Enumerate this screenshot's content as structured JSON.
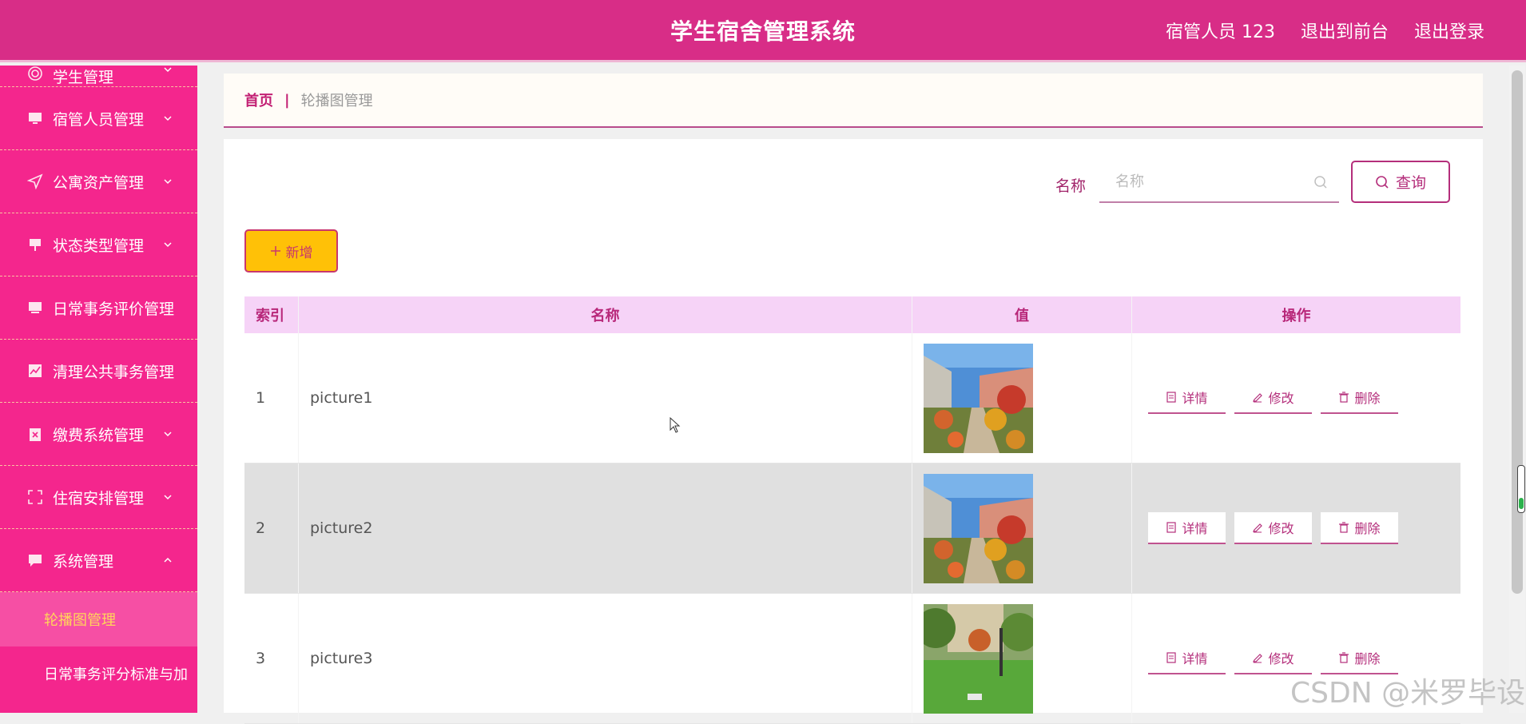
{
  "header": {
    "title": "学生宿舍管理系统",
    "user_label": "宿管人员 123",
    "front_link": "退出到前台",
    "logout_link": "退出登录"
  },
  "sidebar": {
    "items": [
      {
        "label": "学生管理",
        "icon": "target-icon"
      },
      {
        "label": "宿管人员管理",
        "icon": "monitor-icon"
      },
      {
        "label": "公寓资产管理",
        "icon": "send-icon"
      },
      {
        "label": "状态类型管理",
        "icon": "pin-icon"
      },
      {
        "label": "日常事务评价管理",
        "icon": "monitor-icon"
      },
      {
        "label": "清理公共事务管理",
        "icon": "chart-icon"
      },
      {
        "label": "缴费系统管理",
        "icon": "clipboard-x-icon"
      },
      {
        "label": "住宿安排管理",
        "icon": "fullscreen-icon"
      },
      {
        "label": "系统管理",
        "icon": "chat-icon"
      }
    ],
    "submenu": [
      "轮播图管理",
      "日常事务评分标准与加"
    ]
  },
  "breadcrumb": {
    "home": "首页",
    "separator": "|",
    "current": "轮播图管理"
  },
  "search": {
    "label": "名称",
    "placeholder": "名称",
    "button": "查询"
  },
  "add_button": "新增",
  "table": {
    "headers": [
      "索引",
      "名称",
      "值",
      "操作"
    ],
    "rows": [
      {
        "index": "1",
        "name": "picture1"
      },
      {
        "index": "2",
        "name": "picture2"
      },
      {
        "index": "3",
        "name": "picture3"
      }
    ],
    "actions": [
      "详情",
      "修改",
      "删除"
    ]
  },
  "watermark": "CSDN @米罗毕设",
  "colors": {
    "header": "#d82d87",
    "sidebar": "#f4268d",
    "accent": "#b42e7b",
    "add_button": "#ffc107",
    "table_header": "#f6d3f7"
  }
}
